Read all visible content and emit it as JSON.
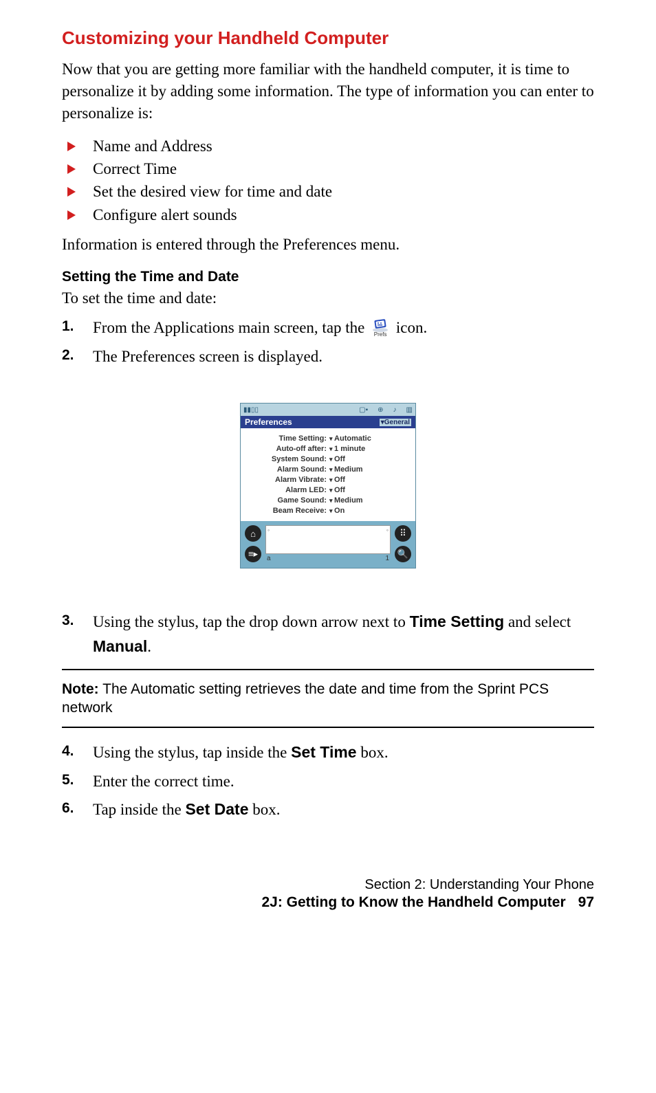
{
  "heading": "Customizing your Handheld Computer",
  "intro": "Now that you are getting more familiar with the handheld computer, it is time to personalize it by adding some information. The type of information you can enter to personalize is:",
  "bullets": [
    "Name and Address",
    "Correct Time",
    "Set the desired view for time and date",
    "Configure alert sounds"
  ],
  "after_bullets": "Information is entered through the Preferences menu.",
  "subheading": "Setting the Time and Date",
  "sub_intro": "To set the time and date:",
  "step1_a": "From the Applications main screen, tap the ",
  "step1_b": " icon.",
  "prefs_caption": "Prefs",
  "step2": "The Preferences screen is displayed.",
  "device": {
    "title": "Preferences",
    "general": "▾General",
    "prefs": [
      {
        "label": "Time Setting:",
        "value": "Automatic"
      },
      {
        "label": "Auto-off after:",
        "value": "1 minute"
      },
      {
        "label": "System Sound:",
        "value": "Off"
      },
      {
        "label": "Alarm Sound:",
        "value": "Medium"
      },
      {
        "label": "Alarm Vibrate:",
        "value": "Off"
      },
      {
        "label": "Alarm LED:",
        "value": "Off"
      },
      {
        "label": "Game Sound:",
        "value": "Medium"
      },
      {
        "label": "Beam Receive:",
        "value": "On"
      }
    ],
    "silk_a": "a",
    "silk_1": "1"
  },
  "step3_a": "Using the stylus, tap the drop down arrow next to ",
  "step3_b": "Time Setting",
  "step3_c": " and select ",
  "step3_d": "Manual",
  "step3_e": ".",
  "note_label": "Note:",
  "note_text": " The Automatic setting retrieves the date and time from the Sprint PCS network",
  "step4_a": "Using the stylus, tap inside the ",
  "step4_b": "Set Time",
  "step4_c": " box.",
  "step5": "Enter the correct time.",
  "step6_a": "Tap inside the ",
  "step6_b": "Set Date",
  "step6_c": " box.",
  "footer": {
    "line1": "Section 2: Understanding Your Phone",
    "line2": "2J: Getting to Know the Handheld Computer",
    "page": "97"
  },
  "markers": {
    "m1": "1.",
    "m2": "2.",
    "m3": "3.",
    "m4": "4.",
    "m5": "5.",
    "m6": "6."
  }
}
